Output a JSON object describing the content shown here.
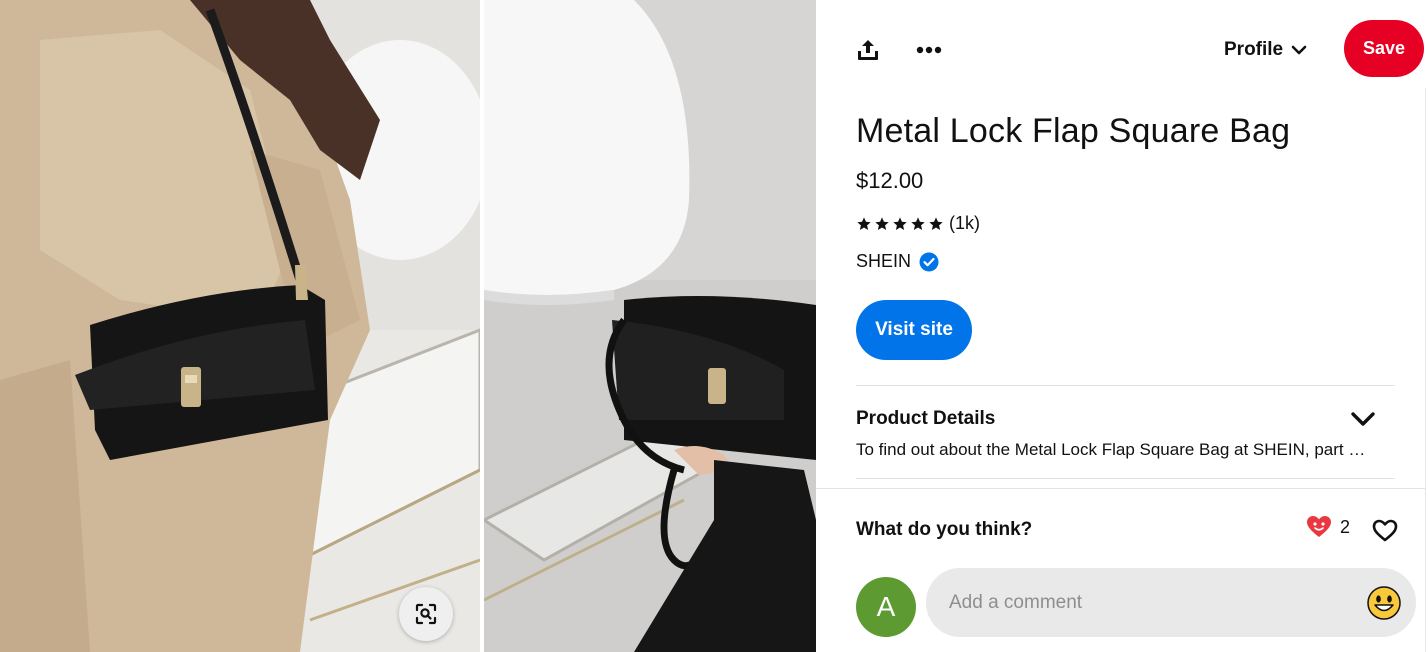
{
  "toolbar": {
    "share_icon": "share-icon",
    "more_icon": "more-icon",
    "profile_label": "Profile",
    "save_label": "Save",
    "save_color": "#e60023"
  },
  "product": {
    "title": "Metal Lock Flap Square Bag",
    "price": "$12.00",
    "rating_stars": 5,
    "rating_count": "(1k)",
    "brand": "SHEIN",
    "visit_label": "Visit site",
    "visit_color": "#0074e8"
  },
  "product_details": {
    "heading": "Product Details",
    "description": "To find out about the Metal Lock Flap Square Bag at SHEIN, part of our latest Shoulder Bags ready to shop online today!"
  },
  "feedback": {
    "heading": "What do you think?",
    "reaction_count": "2"
  },
  "comment": {
    "avatar_letter": "A",
    "placeholder": "Add a comment"
  }
}
